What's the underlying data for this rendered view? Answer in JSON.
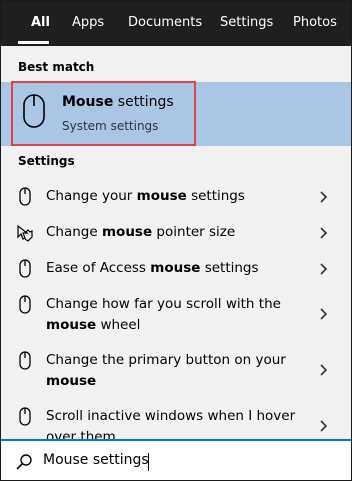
{
  "tabs": [
    {
      "label": "All",
      "active": true
    },
    {
      "label": "Apps",
      "active": false
    },
    {
      "label": "Documents",
      "active": false
    },
    {
      "label": "Settings",
      "active": false
    },
    {
      "label": "Photos",
      "active": false
    }
  ],
  "best_match": {
    "header": "Best match",
    "title_bold": "Mouse",
    "title_rest": " settings",
    "subtitle": "System settings",
    "icon": "mouse-icon"
  },
  "settings": {
    "header": "Settings",
    "items": [
      {
        "icon": "mouse-icon",
        "pre": "Change your ",
        "bold": "mouse",
        "post": " settings"
      },
      {
        "icon": "mouse-pointer-icon",
        "pre": "Change ",
        "bold": "mouse",
        "post": " pointer size"
      },
      {
        "icon": "mouse-icon",
        "pre": "Ease of Access ",
        "bold": "mouse",
        "post": " settings"
      },
      {
        "icon": "mouse-icon",
        "line1": "Change how far you scroll with the",
        "bold": "mouse",
        "post": " wheel"
      },
      {
        "icon": "mouse-icon",
        "line1": "Change the primary button on your",
        "bold": "mouse",
        "post": ""
      },
      {
        "icon": "mouse-icon",
        "line1": "Scroll inactive windows when I hover",
        "line2": "over them"
      }
    ]
  },
  "search": {
    "value": "Mouse settings",
    "icon": "search-icon"
  },
  "colors": {
    "tab_bar": "#1f1f1f",
    "selection": "#a9c7e5",
    "highlight_outline": "#e0424a",
    "search_accent": "#0078d7"
  }
}
